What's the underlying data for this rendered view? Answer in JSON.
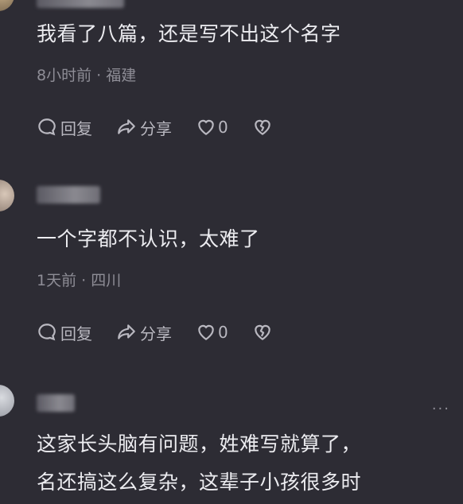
{
  "comments": [
    {
      "text": "我看了八篇，还是写不出这个名字",
      "time": "8小时前",
      "location": "福建",
      "reply_label": "回复",
      "share_label": "分享",
      "like_count": "0"
    },
    {
      "text": "一个字都不认识，太难了",
      "time": "1天前",
      "location": "四川",
      "reply_label": "回复",
      "share_label": "分享",
      "like_count": "0"
    },
    {
      "text_line1": "这家长头脑有问题，姓难写就算了，",
      "text_line2": "名还搞这么复杂，这辈子小孩很多时",
      "more": "···"
    }
  ],
  "separator": " · "
}
